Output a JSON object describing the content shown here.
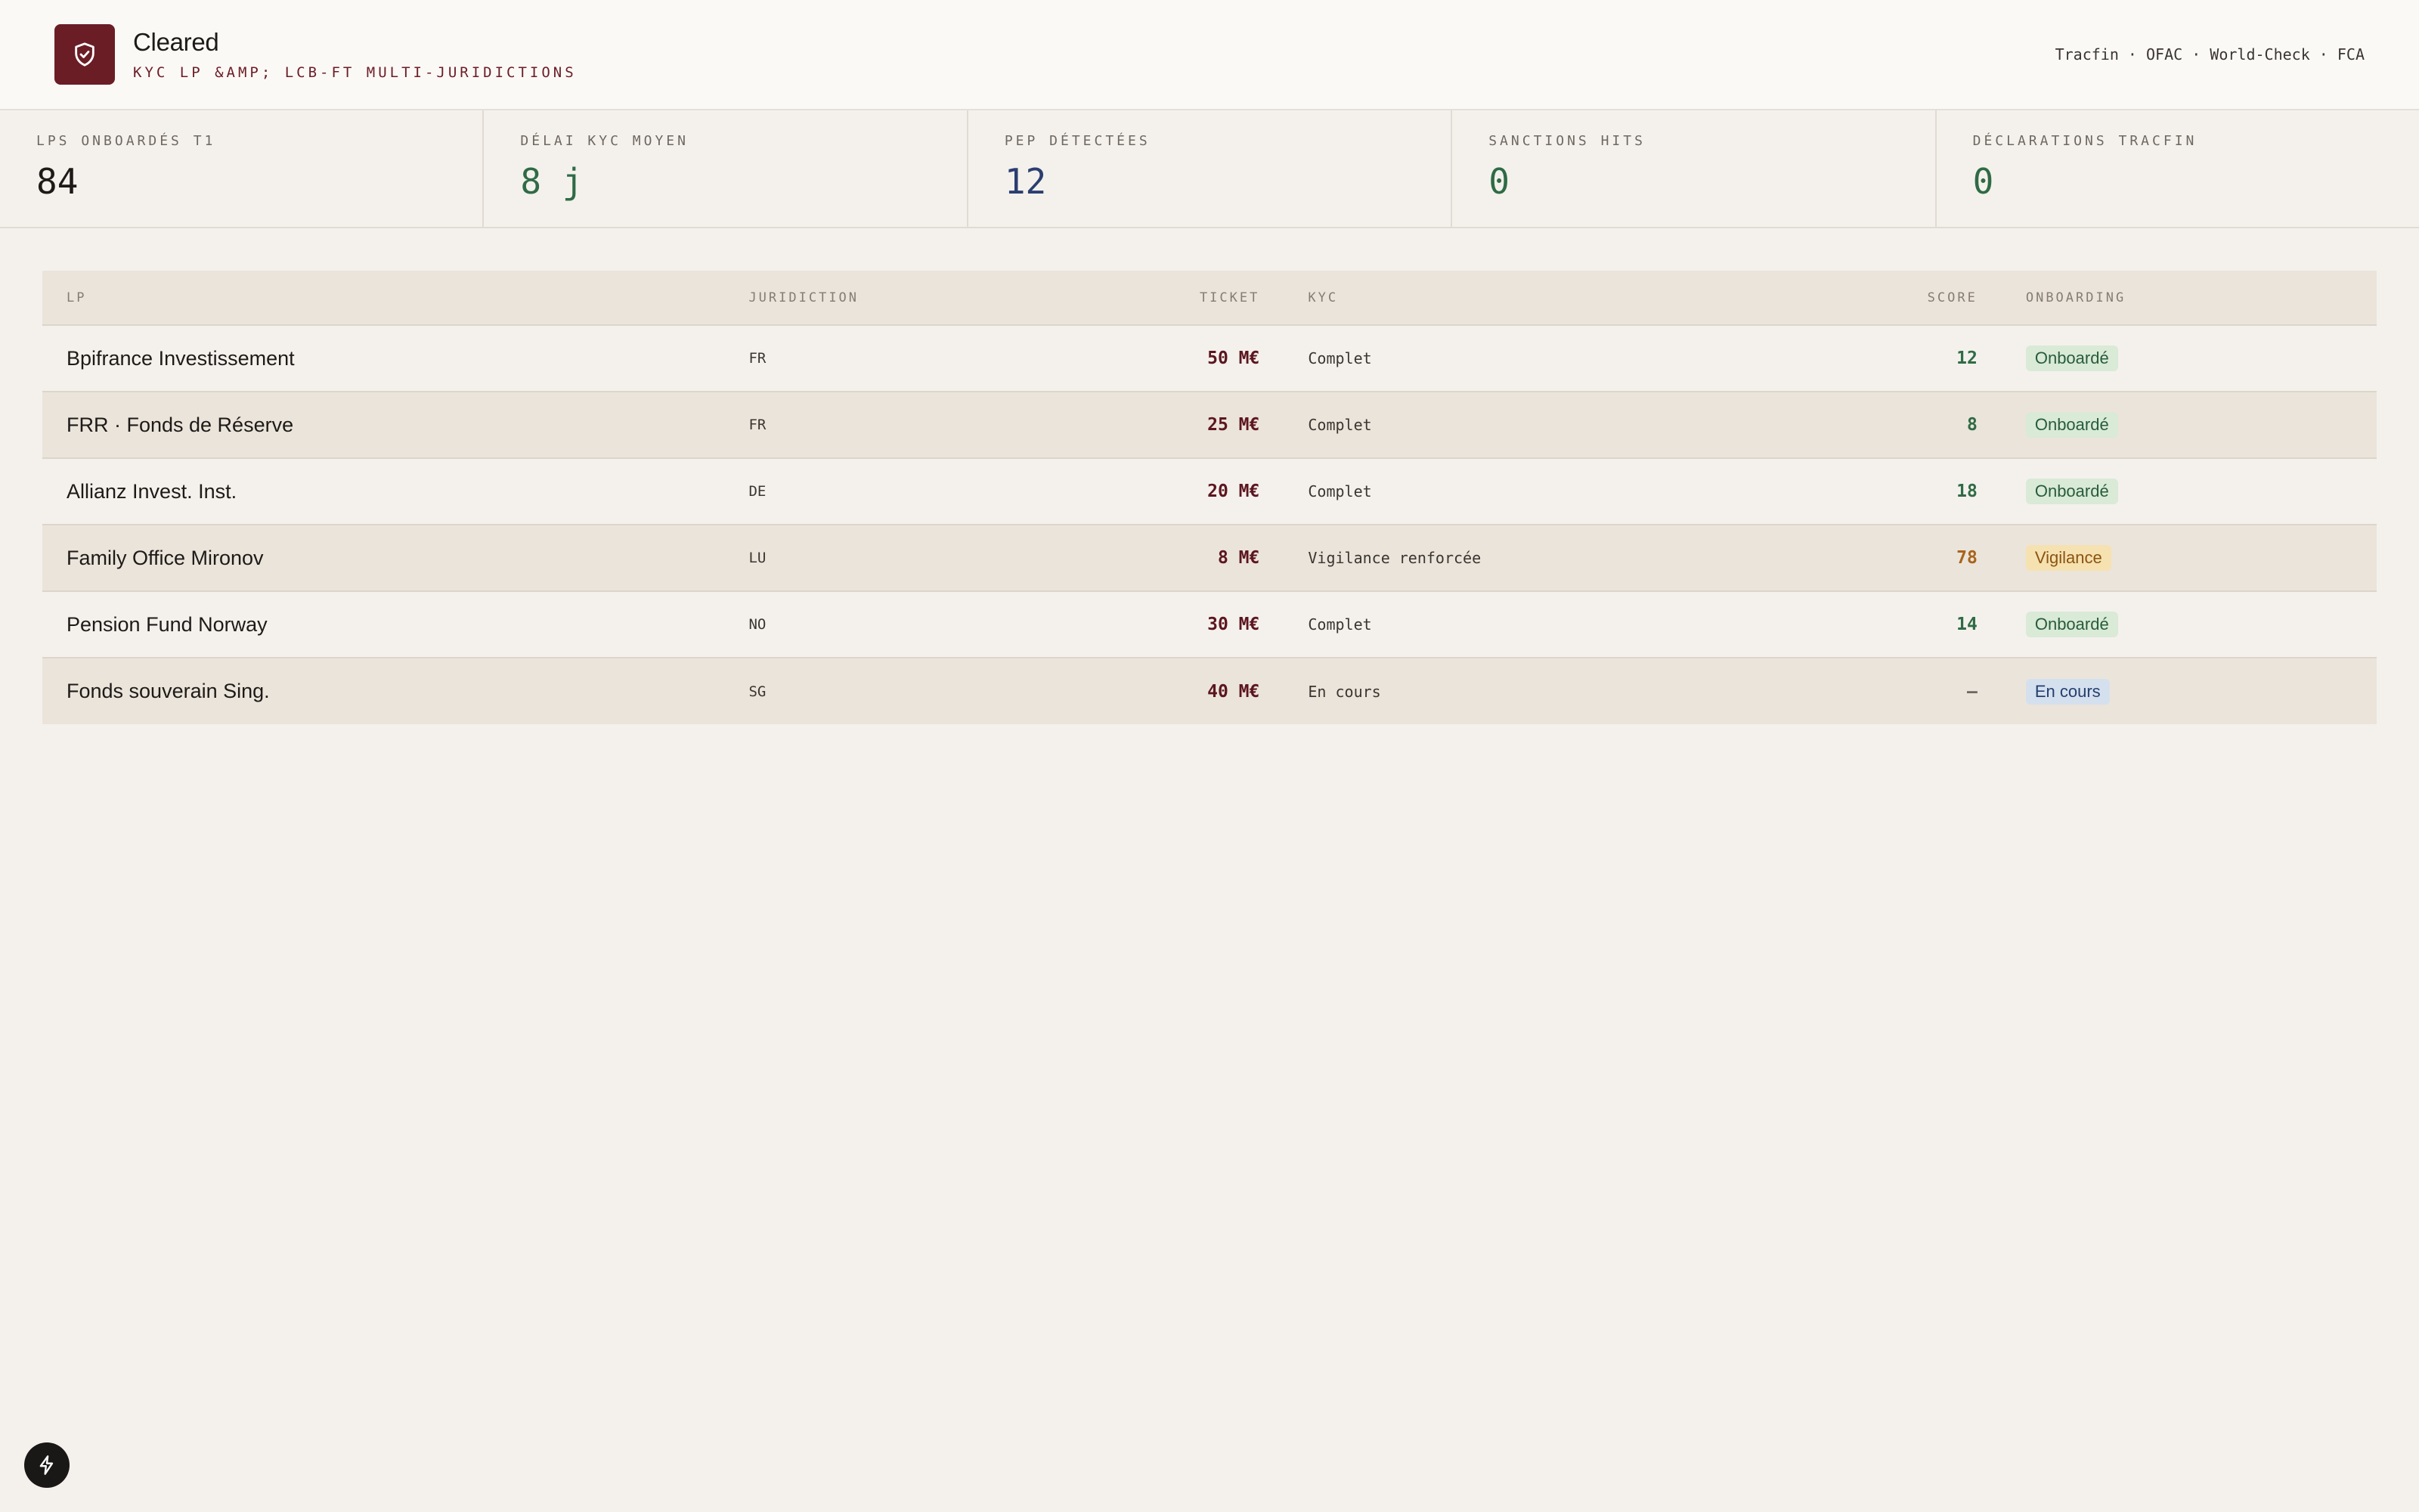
{
  "header": {
    "title": "Cleared",
    "subtitle": "KYC LP &AMP; LCB-FT MULTI-JURIDICTIONS",
    "sources": "Tracfin · OFAC · World-Check · FCA"
  },
  "kpis": [
    {
      "label": "LPS ONBOARDÉS T1",
      "value": "84",
      "color": "#1d1a18"
    },
    {
      "label": "DÉLAI KYC MOYEN",
      "value": "8 j",
      "color": "#2f6b45"
    },
    {
      "label": "PEP DÉTECTÉES",
      "value": "12",
      "color": "#2c3e70"
    },
    {
      "label": "SANCTIONS HITS",
      "value": "0",
      "color": "#2f6b45"
    },
    {
      "label": "DÉCLARATIONS TRACFIN",
      "value": "0",
      "color": "#2f6b45"
    }
  ],
  "table": {
    "columns": {
      "lp": "LP",
      "jurisdiction": "JURIDICTION",
      "ticket": "TICKET",
      "kyc": "KYC",
      "score": "SCORE",
      "onboarding": "ONBOARDING"
    },
    "rows": [
      {
        "lp": "Bpifrance Investissement",
        "jurisdiction": "FR",
        "ticket": "50 M€",
        "kyc": "Complet",
        "score": "12",
        "status": "Onboardé"
      },
      {
        "lp": "FRR · Fonds de Réserve",
        "jurisdiction": "FR",
        "ticket": "25 M€",
        "kyc": "Complet",
        "score": "8",
        "status": "Onboardé"
      },
      {
        "lp": "Allianz Invest. Inst.",
        "jurisdiction": "DE",
        "ticket": "20 M€",
        "kyc": "Complet",
        "score": "18",
        "status": "Onboardé"
      },
      {
        "lp": "Family Office Mironov",
        "jurisdiction": "LU",
        "ticket": "8 M€",
        "kyc": "Vigilance renforcée",
        "score": "78",
        "status": "Vigilance"
      },
      {
        "lp": "Pension Fund Norway",
        "jurisdiction": "NO",
        "ticket": "30 M€",
        "kyc": "Complet",
        "score": "14",
        "status": "Onboardé"
      },
      {
        "lp": "Fonds souverain Sing.",
        "jurisdiction": "SG",
        "ticket": "40 M€",
        "kyc": "En cours",
        "score": "—",
        "status": "En cours"
      }
    ]
  },
  "colors": {
    "brand": "#6b1d26",
    "score_low": "#2f6b45",
    "score_high": "#a8641c",
    "score_pending": "#6f6862"
  },
  "icons": {
    "logo": "shield-check-icon",
    "fab": "bolt-icon"
  }
}
